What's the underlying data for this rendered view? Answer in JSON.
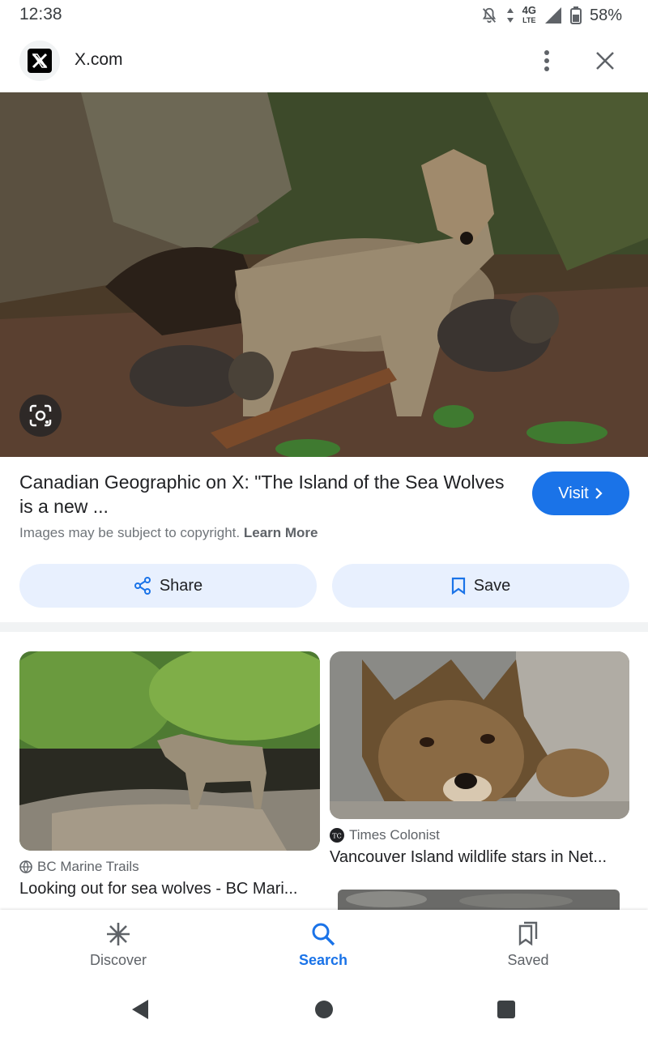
{
  "status_bar": {
    "time": "12:38",
    "network": "4G",
    "network_sub": "LTE",
    "battery": "58%"
  },
  "header": {
    "site": "X.com"
  },
  "result": {
    "title": "Canadian Geographic on X: \"The Island of the Sea Wolves is a new ...",
    "visit_label": "Visit",
    "copyright_text": "Images may be subject to copyright.",
    "learn_more": "Learn More",
    "share_label": "Share",
    "save_label": "Save"
  },
  "related": [
    {
      "source": "BC Marine Trails",
      "title": "Looking out for sea wolves - BC Mari..."
    },
    {
      "source": "Times Colonist",
      "title": "Vancouver Island wildlife stars in Net..."
    }
  ],
  "bottom_nav": {
    "discover": "Discover",
    "search": "Search",
    "saved": "Saved"
  },
  "colors": {
    "accent": "#1a73e8",
    "chip_bg": "#e8f0fe"
  }
}
